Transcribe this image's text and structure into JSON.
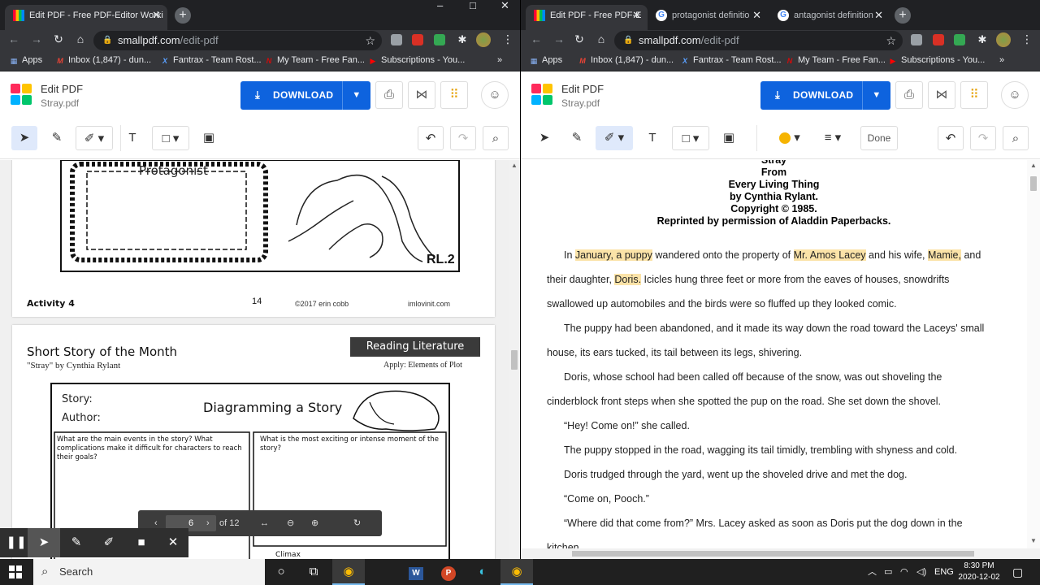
{
  "left": {
    "tabs": [
      {
        "title": "Edit PDF - Free PDF-Editor Worki",
        "favicon": "smallpdf-icon",
        "active": true
      }
    ],
    "window_controls": [
      "–",
      "□",
      "✕"
    ],
    "url": {
      "host": "smallpdf.com",
      "path": "/edit-pdf"
    },
    "bookmarks": [
      "Apps",
      "Inbox (1,847) - dun...",
      "Fantrax - Team Rost...",
      "My Team - Free Fan...",
      "Subscriptions - You..."
    ],
    "bookmarks_more": "»",
    "app": {
      "title": "Edit PDF",
      "file": "Stray.pdf",
      "download": "DOWNLOAD"
    },
    "pages": {
      "activity": {
        "box_label": "Protagonist",
        "code": "RL.2",
        "footer_left": "Activity 4",
        "page_number": "14",
        "copyright": "©2017 erin cobb",
        "site": "imlovinit.com"
      },
      "story": {
        "title": "Short Story of the Month",
        "subtitle": "\"Stray\" by Cynthia Rylant",
        "banner": "Reading Literature",
        "apply": "Apply: Elements of Plot",
        "story_label": "Story:",
        "author_label": "Author:",
        "diagram_title": "Diagramming a Story",
        "q1": "What are the main events in the story? What complications make it difficult for characters to reach their goals?",
        "q2": "What is the most exciting or intense moment of the story?",
        "climax": "Climax"
      }
    },
    "page_control": {
      "current": "6",
      "total": "of 12"
    },
    "annotation_bar": [
      "pause-icon",
      "cursor-icon",
      "pen-icon",
      "marker-icon",
      "camera-icon",
      "close-icon"
    ]
  },
  "right": {
    "tabs": [
      {
        "title": "Edit PDF - Free PDF-E",
        "favicon": "smallpdf-icon",
        "active": true
      },
      {
        "title": "protagonist definitio",
        "favicon": "google-icon",
        "active": false
      },
      {
        "title": "antagonist definition",
        "favicon": "google-icon",
        "active": false
      }
    ],
    "url": {
      "host": "smallpdf.com",
      "path": "/edit-pdf"
    },
    "bookmarks": [
      "Apps",
      "Inbox (1,847) - dun...",
      "Fantrax - Team Rost...",
      "My Team - Free Fan...",
      "Subscriptions - You..."
    ],
    "bookmarks_more": "»",
    "app": {
      "title": "Edit PDF",
      "file": "Stray.pdf",
      "download": "DOWNLOAD",
      "done": "Done",
      "highlight_color": "#f6b400"
    },
    "document": {
      "heading": [
        "Stray",
        "From",
        "Every Living Thing",
        "by Cynthia Rylant.",
        "Copyright © 1985.",
        "Reprinted by permission of Aladdin Paperbacks."
      ],
      "lines": [
        {
          "parts": [
            [
              "In ",
              false
            ],
            [
              "January, a puppy",
              true
            ],
            [
              " wandered onto the property of ",
              false
            ],
            [
              "Mr. Amos Lacey",
              true
            ],
            [
              " and his wife, ",
              false
            ],
            [
              "Mamie,",
              true
            ],
            [
              " and",
              false
            ]
          ]
        },
        {
          "parts": [
            [
              "their daughter, ",
              false
            ],
            [
              "Doris.",
              true
            ],
            [
              " Icicles hung three feet or more from the eaves of houses, snowdrifts",
              false
            ]
          ]
        },
        {
          "parts": [
            [
              "swallowed up automobiles and the birds were so fluffed up they looked comic.",
              false
            ]
          ]
        },
        {
          "parts": [
            [
              "The puppy had been abandoned, and it made its way down the road toward the Laceys' small",
              false
            ]
          ]
        },
        {
          "parts": [
            [
              "house, its ears tucked, its tail between its legs, shivering.",
              false
            ]
          ]
        },
        {
          "parts": [
            [
              "Doris, whose school had been called off because of the snow, was out shoveling the",
              false
            ]
          ]
        },
        {
          "parts": [
            [
              "cinderblock front steps when she spotted the pup on the road. She set down the shovel.",
              false
            ]
          ]
        },
        {
          "parts": [
            [
              "“Hey! Come on!” she called.",
              false
            ]
          ]
        },
        {
          "parts": [
            [
              "The puppy stopped in the road, wagging its tail timidly, trembling with shyness and cold.",
              false
            ]
          ]
        },
        {
          "parts": [
            [
              "Doris trudged through the yard, went up the shoveled drive and met the dog.",
              false
            ]
          ]
        },
        {
          "parts": [
            [
              "“Come on, Pooch.”",
              false
            ]
          ]
        },
        {
          "parts": [
            [
              "“Where did that come from?” Mrs. Lacey asked as soon as Doris put the dog down in the",
              false
            ]
          ]
        },
        {
          "parts": [
            [
              "kitchen.",
              false
            ]
          ]
        }
      ]
    }
  },
  "taskbar": {
    "search_placeholder": "Search",
    "apps": [
      "cortana-icon",
      "task-view-icon",
      "chrome-icon",
      "word-icon",
      "powerpoint-icon",
      "edge-icon",
      "chrome-icon"
    ],
    "language": "ENG",
    "time": "8:30 PM",
    "date": "2020-12-02"
  }
}
